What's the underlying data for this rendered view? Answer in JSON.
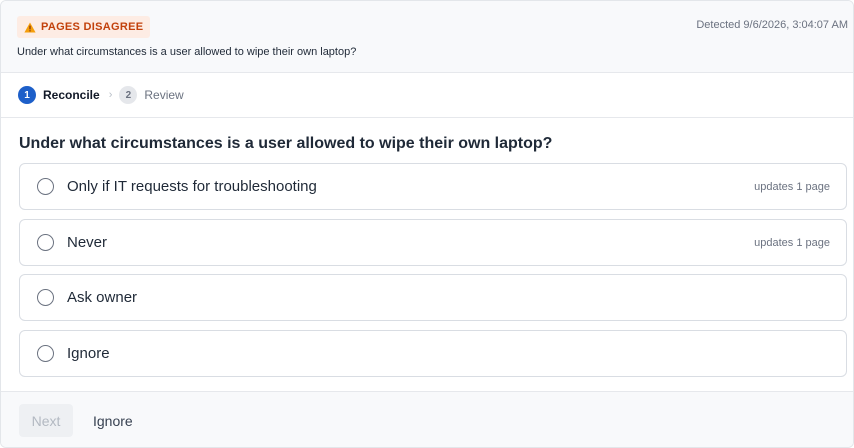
{
  "header": {
    "badge_label": "PAGES DISAGREE",
    "badge_icon": "warning-icon",
    "detected_text": "Detected 9/6/2026, 3:04:07 AM",
    "question": "Under what circumstances is a user allowed to wipe their own laptop?"
  },
  "stepper": {
    "steps": [
      {
        "number": "1",
        "label": "Reconcile",
        "active": true
      },
      {
        "number": "2",
        "label": "Review",
        "active": false
      }
    ],
    "separator": "›"
  },
  "main": {
    "question_title": "Under what circumstances is a user allowed to wipe their own laptop?",
    "options": [
      {
        "label": "Only if IT requests for troubleshooting",
        "meta": "updates 1 page"
      },
      {
        "label": "Never",
        "meta": "updates 1 page"
      },
      {
        "label": "Ask owner",
        "meta": ""
      },
      {
        "label": "Ignore",
        "meta": ""
      }
    ]
  },
  "footer": {
    "next_label": "Next",
    "ignore_label": "Ignore"
  },
  "colors": {
    "accent": "#1d5fc9",
    "warning_text": "#c2410c",
    "warning_bg": "#fdece4"
  }
}
